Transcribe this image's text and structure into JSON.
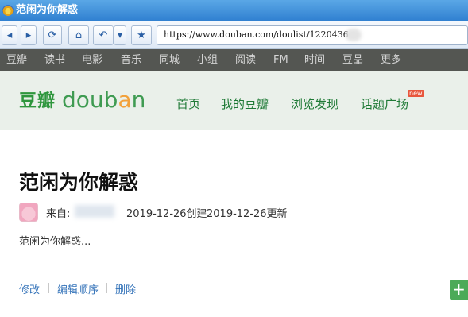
{
  "window": {
    "title": "范闲为你解惑",
    "icon": "browser-logo-icon"
  },
  "toolbar": {
    "address": "https://www.douban.com/doulist/1220436",
    "back_icon": "◂",
    "forward_icon": "▸",
    "refresh_icon": "⟳",
    "home_icon": "⌂",
    "undo_icon": "↶",
    "dropdown_icon": "▾",
    "favorite_icon": "★"
  },
  "global_nav": [
    "豆瓣",
    "读书",
    "电影",
    "音乐",
    "同城",
    "小组",
    "阅读",
    "FM",
    "时间",
    "豆品",
    "更多"
  ],
  "site_header": {
    "logo_cn": "豆瓣",
    "logo_en_parts": [
      "d",
      "o",
      "u",
      "b",
      "a",
      "n"
    ],
    "nav": [
      "首页",
      "我的豆瓣",
      "浏览发现",
      "话题广场"
    ],
    "new_badge": "new"
  },
  "doulist": {
    "title": "范闲为你解惑",
    "from_label": "来自:",
    "created": "2019-12-26创建",
    "updated": "2019-12-26更新",
    "description": "范闲为你解惑..."
  },
  "actions": [
    "修改",
    "编辑顺序",
    "删除"
  ],
  "plus_label": "+",
  "colors": {
    "accent_green": "#2e963d",
    "link_blue": "#3473b9",
    "titlebar_blue": "#2f7fd0"
  }
}
